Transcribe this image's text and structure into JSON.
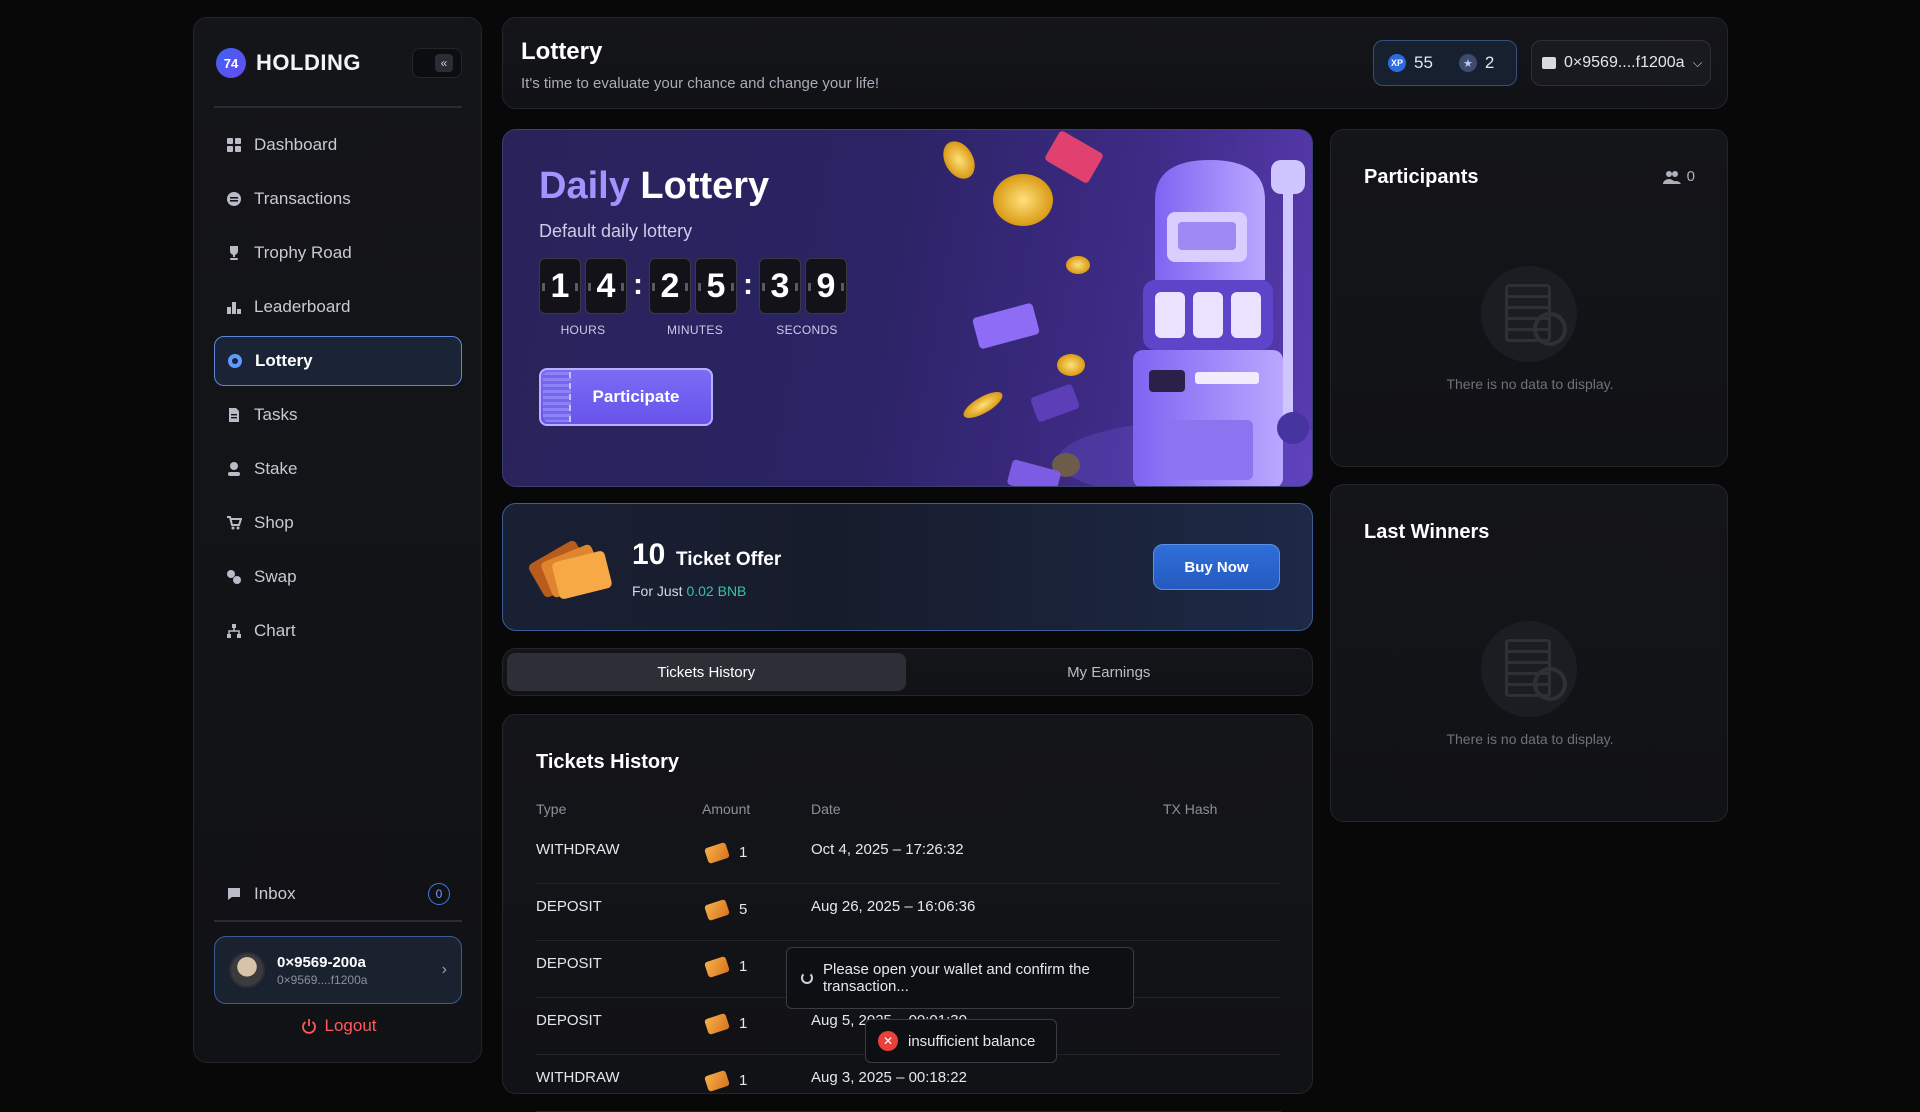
{
  "sidebar": {
    "brand": {
      "mark": "74",
      "name": "HOLDING"
    },
    "collapse_icon": "double-chevron-left-icon",
    "items": [
      {
        "label": "Dashboard",
        "icon": "grid-icon"
      },
      {
        "label": "Transactions",
        "icon": "coin-icon"
      },
      {
        "label": "Trophy Road",
        "icon": "trophy-icon"
      },
      {
        "label": "Leaderboard",
        "icon": "podium-icon"
      },
      {
        "label": "Lottery",
        "icon": "lottery-icon",
        "active": true
      },
      {
        "label": "Tasks",
        "icon": "document-icon"
      },
      {
        "label": "Stake",
        "icon": "stake-icon"
      },
      {
        "label": "Shop",
        "icon": "cart-icon"
      },
      {
        "label": "Swap",
        "icon": "swap-icon"
      },
      {
        "label": "Chart",
        "icon": "hierarchy-icon"
      }
    ],
    "inbox": {
      "label": "Inbox",
      "count": "0"
    },
    "user": {
      "name": "0×9569-200a",
      "address": "0×9569....f1200a"
    },
    "logout": "Logout"
  },
  "header": {
    "title": "Lottery",
    "subtitle": "It's time to evaluate your chance and change your life!",
    "xp": {
      "icon_label": "XP",
      "value": "55"
    },
    "stars": {
      "value": "2"
    },
    "wallet": "0×9569....f1200a"
  },
  "hero": {
    "title_accent": "Daily",
    "title_main": "Lottery",
    "subtitle": "Default daily lottery",
    "timer": {
      "hours": [
        "1",
        "4"
      ],
      "minutes": [
        "2",
        "5"
      ],
      "seconds": [
        "3",
        "9"
      ],
      "separator": ":"
    },
    "labels": {
      "hours": "HOURS",
      "minutes": "MINUTES",
      "seconds": "SECONDS"
    },
    "button": "Participate"
  },
  "offer": {
    "count": "10",
    "label": "Ticket Offer",
    "prefix": "For Just",
    "price": "0.02 BNB",
    "button": "Buy Now"
  },
  "tabs": [
    {
      "label": "Tickets History",
      "active": true
    },
    {
      "label": "My Earnings",
      "active": false
    }
  ],
  "tickets": {
    "title": "Tickets History",
    "columns": [
      "Type",
      "Amount",
      "Date",
      "TX Hash"
    ],
    "rows": [
      {
        "type": "WITHDRAW",
        "amount": "1",
        "date": "Oct 4, 2025 – 17:26:32"
      },
      {
        "type": "DEPOSIT",
        "amount": "5",
        "date": "Aug 26, 2025 – 16:06:36"
      },
      {
        "type": "DEPOSIT",
        "amount": "1",
        "date": ""
      },
      {
        "type": "DEPOSIT",
        "amount": "1",
        "date": "Aug 5, 2025 – 00:01:30"
      },
      {
        "type": "WITHDRAW",
        "amount": "1",
        "date": "Aug 3, 2025 – 00:18:22"
      }
    ]
  },
  "participants": {
    "title": "Participants",
    "count": "0",
    "empty": "There is no data to display."
  },
  "winners": {
    "title": "Last Winners",
    "empty": "There is no data to display."
  },
  "toasts": {
    "wallet": "Please open your wallet and confirm the transaction...",
    "error": "insufficient balance"
  }
}
